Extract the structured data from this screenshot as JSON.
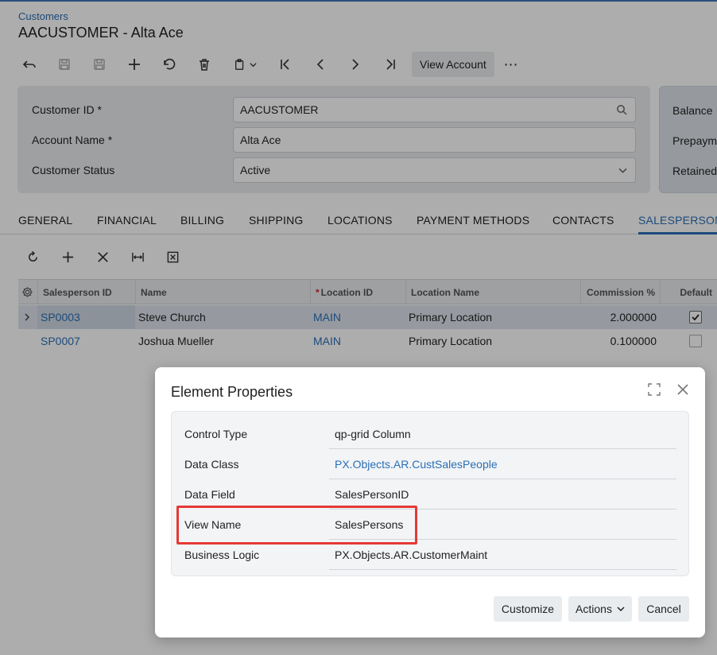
{
  "breadcrumb": "Customers",
  "page_title": "AACUSTOMER - Alta Ace",
  "toolbar": {
    "view_account_label": "View Account",
    "more_label": "⋯"
  },
  "summary": {
    "customer_id_label": "Customer ID *",
    "customer_id_value": "AACUSTOMER",
    "account_name_label": "Account Name *",
    "account_name_value": "Alta Ace",
    "customer_status_label": "Customer Status",
    "customer_status_value": "Active"
  },
  "summary2": {
    "balance_label": "Balance",
    "prepayments_label": "Prepaym",
    "retained_label": "Retained"
  },
  "tabs": [
    {
      "label": "GENERAL"
    },
    {
      "label": "FINANCIAL"
    },
    {
      "label": "BILLING"
    },
    {
      "label": "SHIPPING"
    },
    {
      "label": "LOCATIONS"
    },
    {
      "label": "PAYMENT METHODS"
    },
    {
      "label": "CONTACTS"
    },
    {
      "label": "SALESPERSON"
    }
  ],
  "grid": {
    "headers": {
      "salesperson_id": "Salesperson ID",
      "name": "Name",
      "location_id_req": "*",
      "location_id": "Location ID",
      "location_name": "Location Name",
      "commission": "Commission %",
      "default": "Default"
    },
    "rows": [
      {
        "salesperson_id": "SP0003",
        "name": "Steve Church",
        "location_id": "MAIN",
        "location_name": "Primary Location",
        "commission": "2.000000",
        "default": true
      },
      {
        "salesperson_id": "SP0007",
        "name": "Joshua Mueller",
        "location_id": "MAIN",
        "location_name": "Primary Location",
        "commission": "0.100000",
        "default": false
      }
    ]
  },
  "dialog": {
    "title": "Element Properties",
    "properties": [
      {
        "label": "Control Type",
        "value": "qp-grid Column"
      },
      {
        "label": "Data Class",
        "value": "PX.Objects.AR.CustSalesPeople"
      },
      {
        "label": "Data Field",
        "value": "SalesPersonID"
      },
      {
        "label": "View Name",
        "value": "SalesPersons"
      },
      {
        "label": "Business Logic",
        "value": "PX.Objects.AR.CustomerMaint"
      }
    ],
    "buttons": {
      "customize": "Customize",
      "actions": "Actions",
      "cancel": "Cancel"
    }
  },
  "colors": {
    "accent": "#2a6fb5",
    "highlight": "#e53935"
  }
}
